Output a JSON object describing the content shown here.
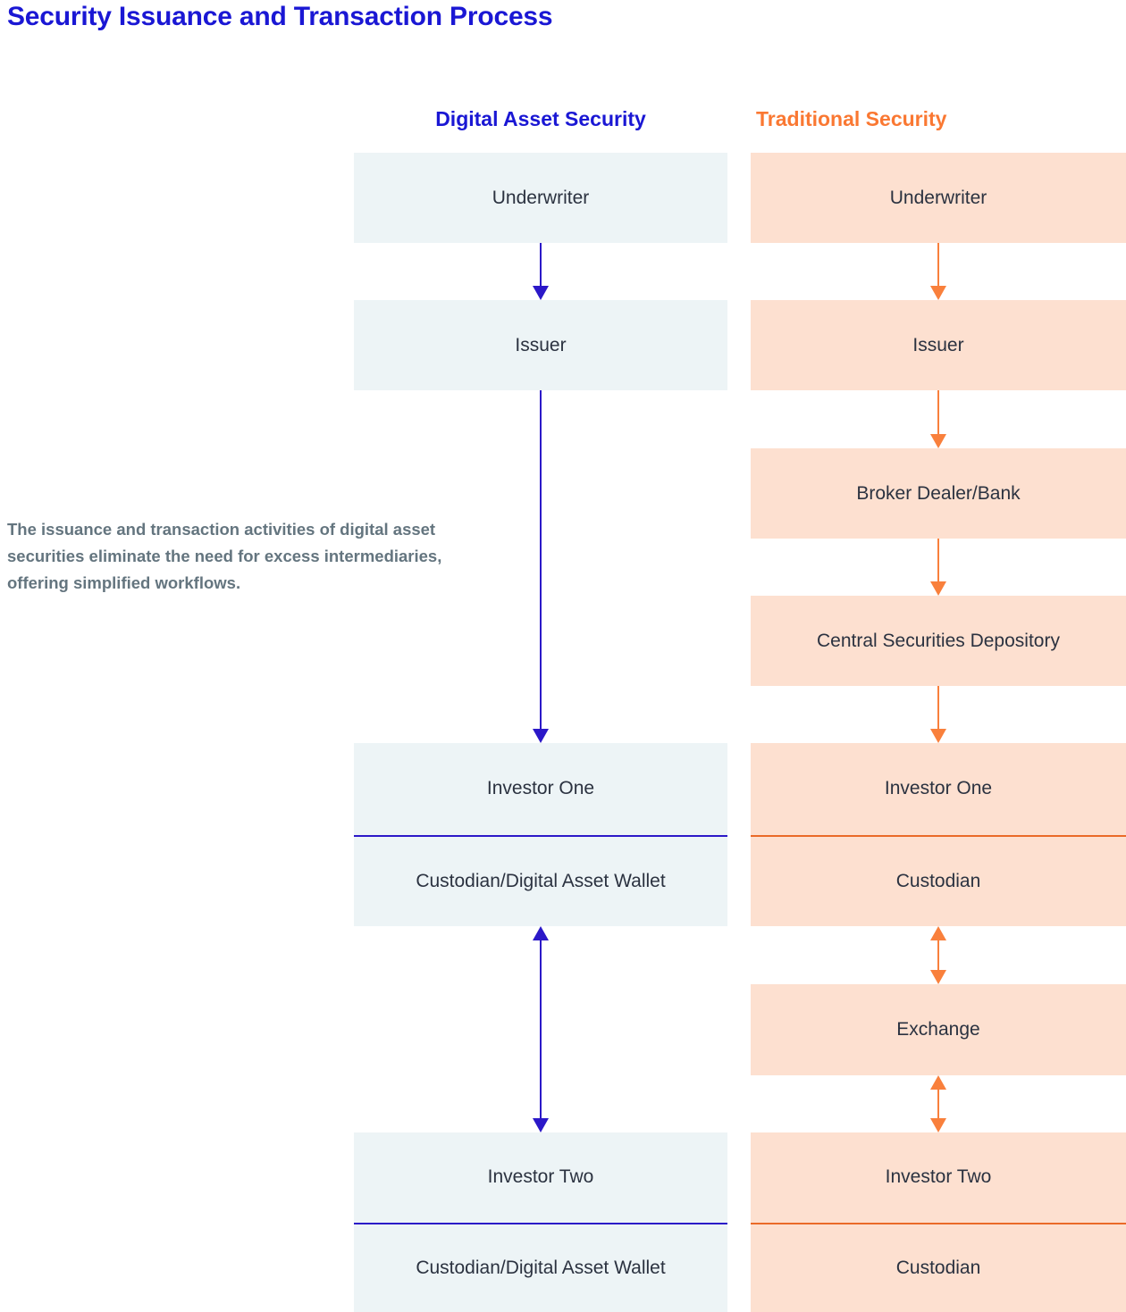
{
  "title": "Security Issuance and Transaction Process",
  "side_note": "The issuance and transaction activities of digital asset securities eliminate the need for excess intermediaries, offering simplified workflows.",
  "colors": {
    "title": "#1a17d4",
    "digital_accent": "#1a17d4",
    "traditional_accent": "#fa7832",
    "digital_box_fill": "#edf4f6",
    "traditional_box_fill": "#fde0d0",
    "digital_arrow": "#2b18c8",
    "traditional_arrow": "#f9803c",
    "note_text": "#64757f",
    "box_text": "#2b3240"
  },
  "columns": {
    "digital": {
      "header": "Digital Asset Security",
      "nodes": [
        {
          "label": "Underwriter",
          "type": "single"
        },
        {
          "label": "Issuer",
          "type": "single"
        },
        {
          "label": "Investor One",
          "sublabel": "Custodian/Digital Asset Wallet",
          "type": "split"
        },
        {
          "label": "Investor Two",
          "sublabel": "Custodian/Digital Asset Wallet",
          "type": "split"
        }
      ],
      "connectors": [
        {
          "from": "Underwriter",
          "to": "Issuer",
          "direction": "down"
        },
        {
          "from": "Issuer",
          "to": "Investor One",
          "direction": "down"
        },
        {
          "from": "Custodian/Digital Asset Wallet",
          "to": "Investor Two",
          "direction": "both"
        }
      ]
    },
    "traditional": {
      "header": "Traditional Security",
      "nodes": [
        {
          "label": "Underwriter",
          "type": "single"
        },
        {
          "label": "Issuer",
          "type": "single"
        },
        {
          "label": "Broker Dealer/Bank",
          "type": "single"
        },
        {
          "label": "Central Securities Depository",
          "type": "single"
        },
        {
          "label": "Investor One",
          "sublabel": "Custodian",
          "type": "split"
        },
        {
          "label": "Exchange",
          "type": "single"
        },
        {
          "label": "Investor Two",
          "sublabel": "Custodian",
          "type": "split"
        }
      ],
      "connectors": [
        {
          "from": "Underwriter",
          "to": "Issuer",
          "direction": "down"
        },
        {
          "from": "Issuer",
          "to": "Broker Dealer/Bank",
          "direction": "down"
        },
        {
          "from": "Broker Dealer/Bank",
          "to": "Central Securities Depository",
          "direction": "down"
        },
        {
          "from": "Central Securities Depository",
          "to": "Investor One",
          "direction": "down"
        },
        {
          "from": "Custodian",
          "to": "Exchange",
          "direction": "both"
        },
        {
          "from": "Exchange",
          "to": "Investor Two",
          "direction": "both"
        }
      ]
    }
  }
}
